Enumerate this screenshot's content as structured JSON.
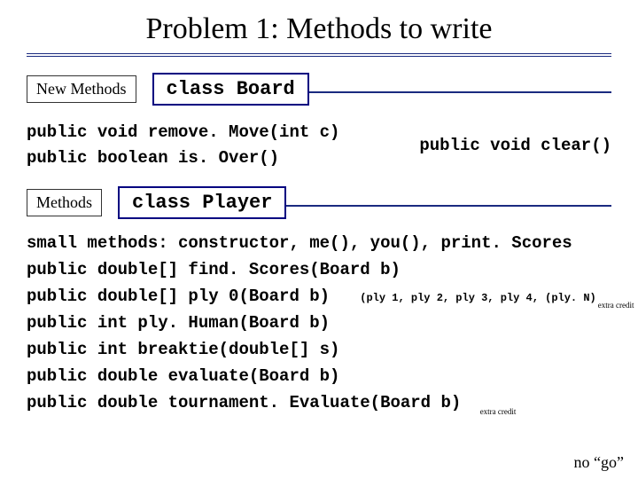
{
  "title": "Problem 1:  Methods to write",
  "section1": {
    "label": "New Methods",
    "class_heading": "class Board",
    "line1": "public void remove. Move(int c)",
    "line2": "public boolean is. Over()",
    "right": "public void clear()"
  },
  "section2": {
    "label": "Methods",
    "class_heading": "class Player",
    "lines": {
      "l0": "small methods: constructor, me(), you(), print. Scores",
      "l1": "public double[] find. Scores(Board b)",
      "l2": "public double[] ply 0(Board b)",
      "l2_ann": "(ply 1, ply 2, ply 3, ply 4, ",
      "l2_plyN": "(ply. N)",
      "l2_close": " )",
      "l2_extra": "extra credit",
      "l3": "public int ply. Human(Board b)",
      "l4": "public int breaktie(double[] s)",
      "l5": "public double evaluate(Board b)",
      "l6": "public double tournament. Evaluate(Board b)",
      "l6_extra": "extra credit"
    }
  },
  "footer_right": "no  “go”"
}
